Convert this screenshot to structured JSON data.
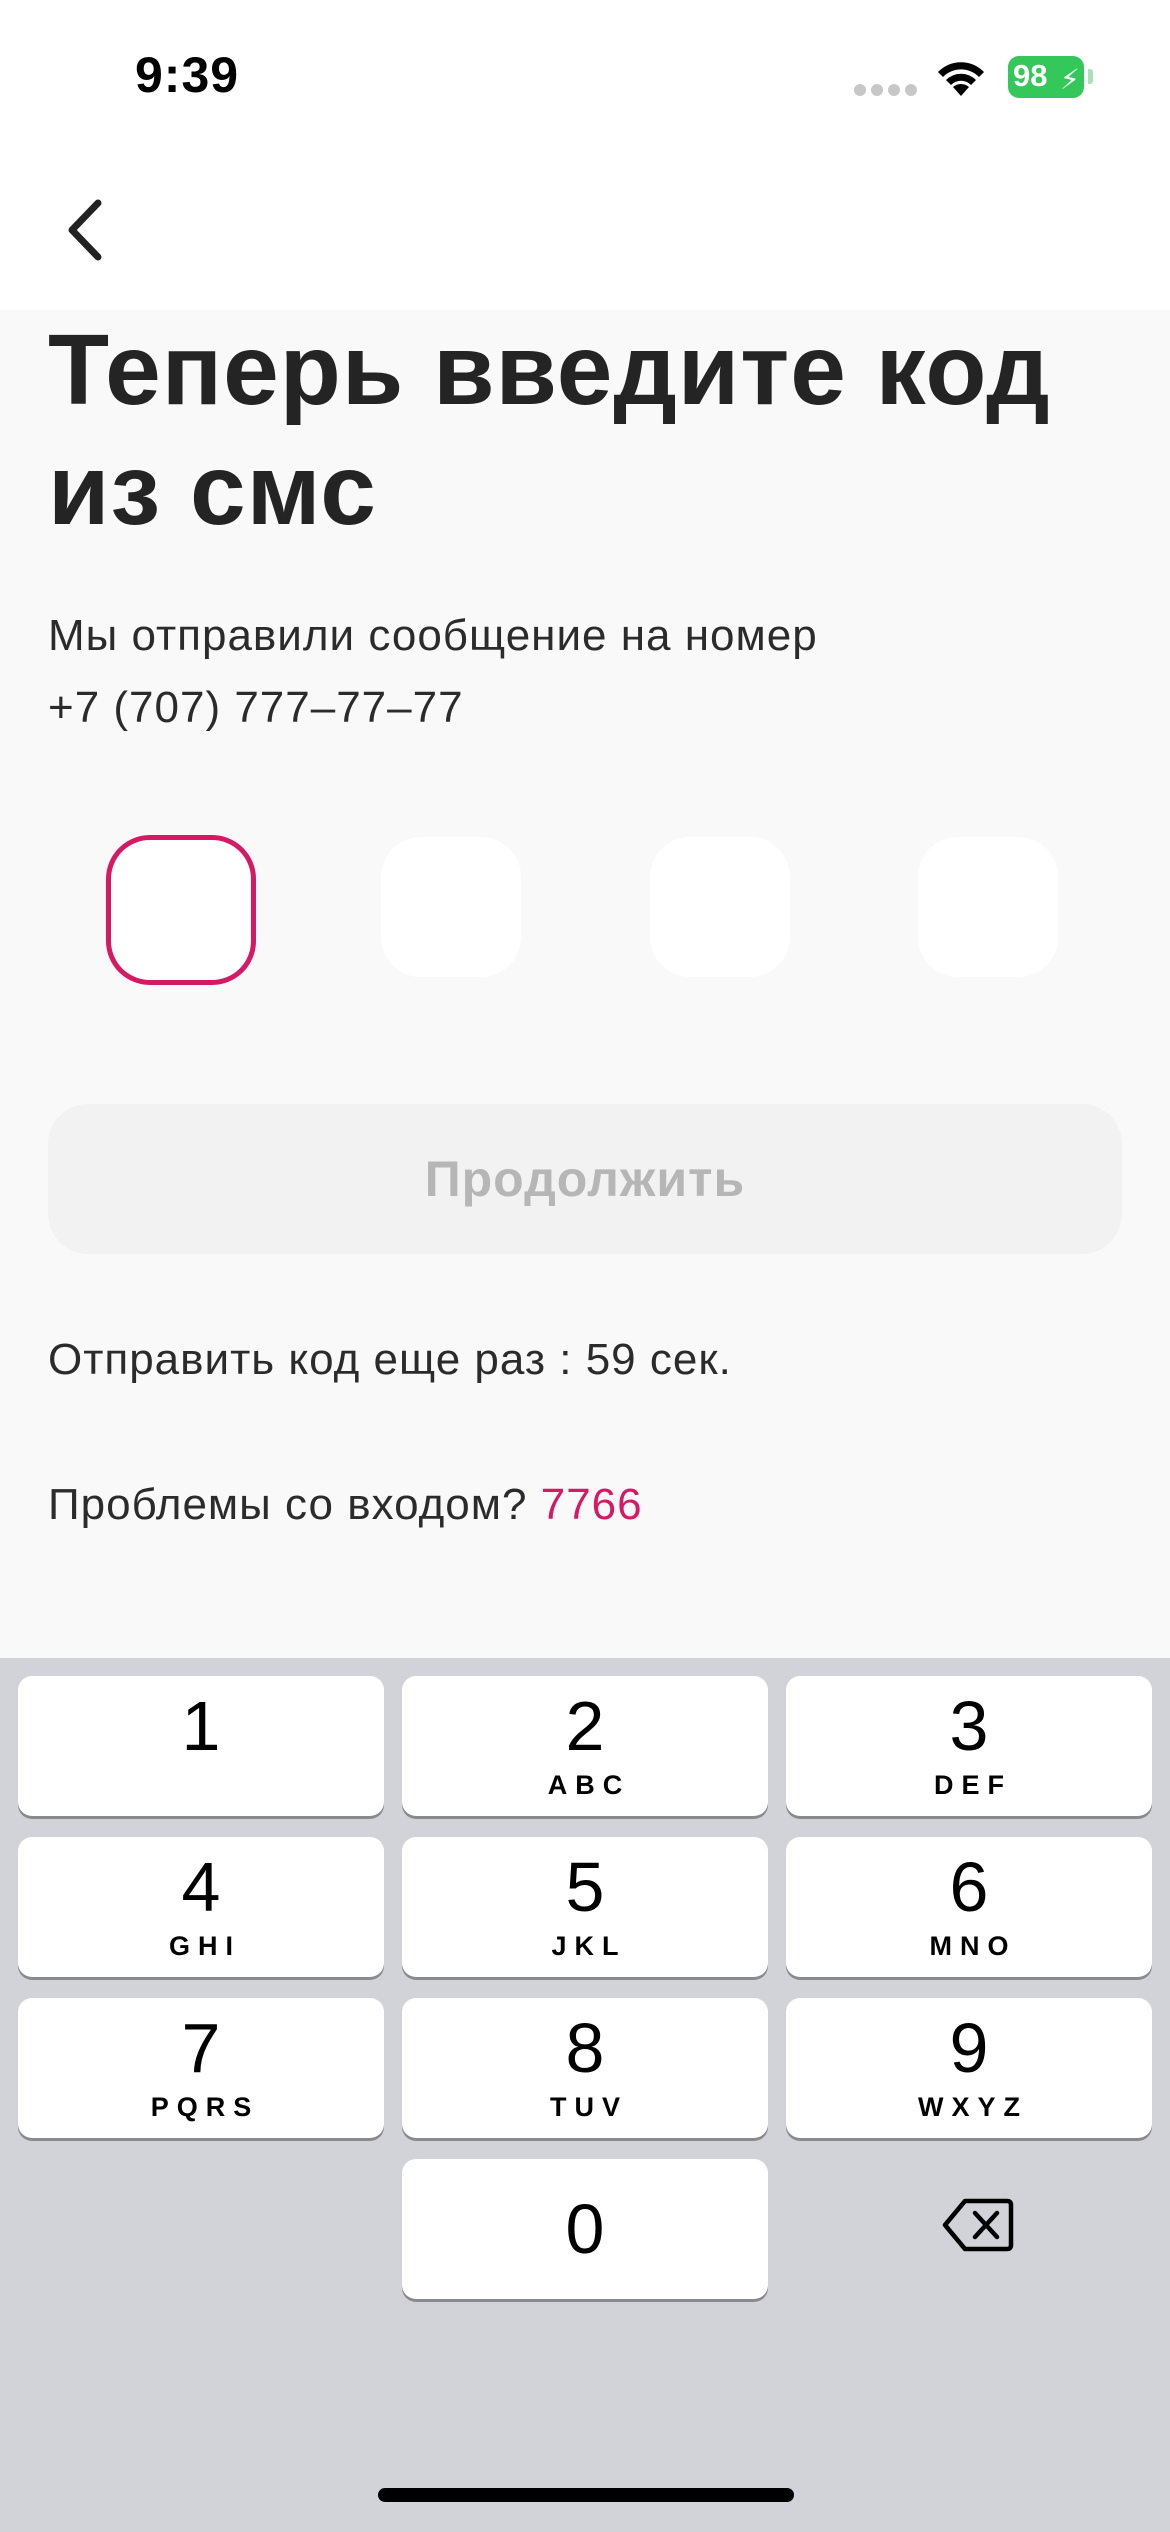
{
  "status_bar": {
    "time": "9:39",
    "battery_level": "98",
    "battery_color": "#34c759"
  },
  "nav": {
    "back_icon": "chevron-left-icon"
  },
  "content": {
    "title": "Теперь введите код из смс",
    "subtitle_line1": "Мы отправили сообщение на номер",
    "phone": "+7 (707) 777–77–77",
    "code_length": 4,
    "code_values": [
      "",
      "",
      "",
      ""
    ],
    "active_index": 0,
    "continue_label": "Продолжить",
    "resend_text": "Отправить код еще раз : 59 сек.",
    "problems_text": "Проблемы со входом?",
    "problems_link": "7766"
  },
  "colors": {
    "accent": "#d41a63",
    "button_disabled_bg": "#f2f2f2",
    "button_disabled_text": "#b6b6b6",
    "background": "#f9f9f9",
    "keyboard_bg": "#d1d3d9"
  },
  "keyboard": {
    "keys": [
      {
        "digit": "1",
        "letters": ""
      },
      {
        "digit": "2",
        "letters": "ABC"
      },
      {
        "digit": "3",
        "letters": "DEF"
      },
      {
        "digit": "4",
        "letters": "GHI"
      },
      {
        "digit": "5",
        "letters": "JKL"
      },
      {
        "digit": "6",
        "letters": "MNO"
      },
      {
        "digit": "7",
        "letters": "PQRS"
      },
      {
        "digit": "8",
        "letters": "TUV"
      },
      {
        "digit": "9",
        "letters": "WXYZ"
      },
      {
        "digit": "0",
        "letters": ""
      }
    ],
    "delete_icon": "backspace-icon"
  }
}
